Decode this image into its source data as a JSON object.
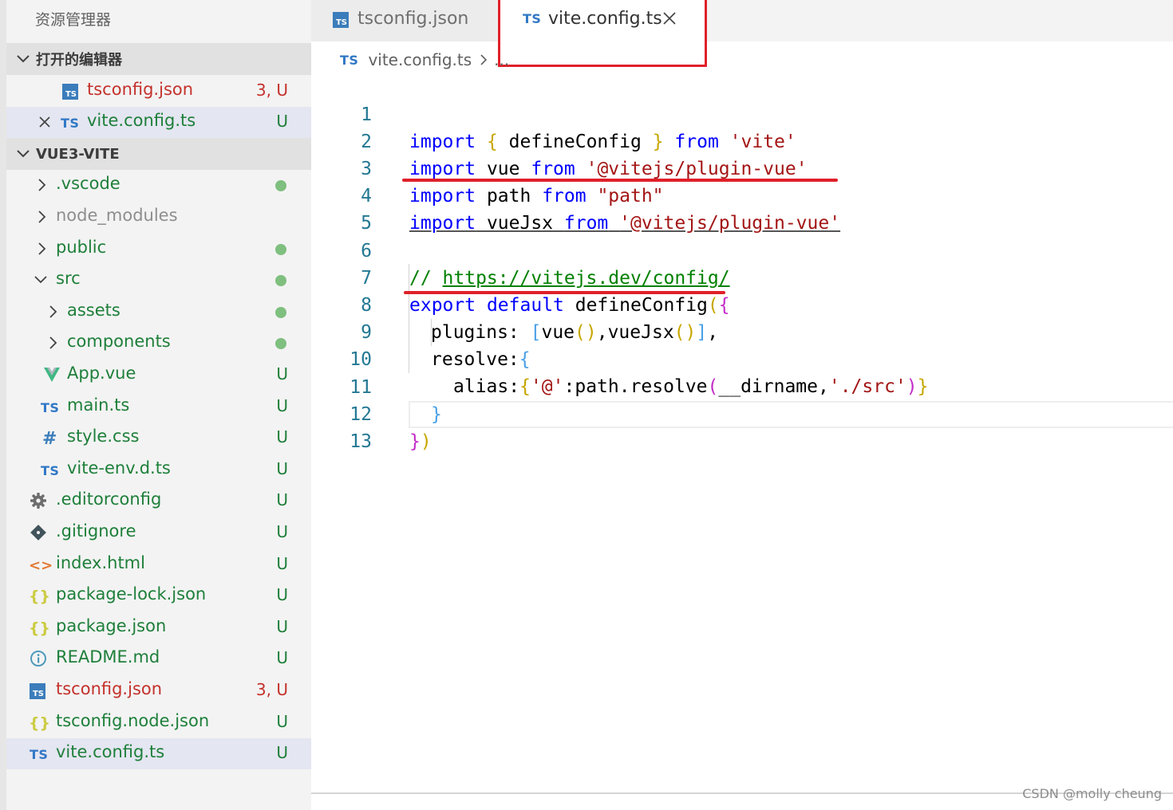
{
  "explorer": {
    "title": "资源管理器",
    "open_editors": {
      "header": "打开的编辑器",
      "items": [
        {
          "name": "tsconfig.json",
          "status": "3, U"
        },
        {
          "name": "vite.config.ts",
          "status": "U"
        }
      ]
    },
    "project": {
      "header": "VUE3-VITE",
      "items": [
        {
          "name": ".vscode",
          "kind": "folder",
          "status": "dot"
        },
        {
          "name": "node_modules",
          "kind": "folder",
          "status": ""
        },
        {
          "name": "public",
          "kind": "folder",
          "status": "dot"
        },
        {
          "name": "src",
          "kind": "folder-open",
          "status": "dot"
        },
        {
          "name": "assets",
          "kind": "folder",
          "status": "dot"
        },
        {
          "name": "components",
          "kind": "folder",
          "status": "dot"
        },
        {
          "name": "App.vue",
          "kind": "vue-icon",
          "status": "U"
        },
        {
          "name": "main.ts",
          "kind": "ts-icon",
          "status": "U"
        },
        {
          "name": "style.css",
          "kind": "hash-icon",
          "status": "U"
        },
        {
          "name": "vite-env.d.ts",
          "kind": "ts-icon",
          "status": "U"
        },
        {
          "name": ".editorconfig",
          "kind": "gear-icon",
          "status": "U"
        },
        {
          "name": ".gitignore",
          "kind": "git-icon",
          "status": "U"
        },
        {
          "name": "index.html",
          "kind": "html-icon",
          "status": "U"
        },
        {
          "name": "package-lock.json",
          "kind": "json-icon",
          "status": "U"
        },
        {
          "name": "package.json",
          "kind": "json-icon",
          "status": "U"
        },
        {
          "name": "README.md",
          "kind": "info-icon",
          "status": "U"
        },
        {
          "name": "tsconfig.json",
          "kind": "tsconfig-icon",
          "status": "3, U"
        },
        {
          "name": "tsconfig.node.json",
          "kind": "json-icon",
          "status": "U"
        },
        {
          "name": "vite.config.ts",
          "kind": "ts-icon",
          "status": "U"
        }
      ]
    }
  },
  "tabs": [
    {
      "label": "tsconfig.json",
      "icon": "tsconfig-icon",
      "active": false
    },
    {
      "label": "vite.config.ts",
      "icon": "ts-icon",
      "active": true
    }
  ],
  "icons": {
    "ts": "TS",
    "ts_box": "TS",
    "hash": "#",
    "vue": "V",
    "html": "<>",
    "json": "{}",
    "info": "i"
  },
  "breadcrumb": {
    "file": "vite.config.ts",
    "more": "..."
  },
  "line_numbers": [
    "1",
    "2",
    "3",
    "4",
    "5",
    "6",
    "7",
    "8",
    "9",
    "10",
    "11",
    "12",
    "13"
  ],
  "code": {
    "l1": [
      "import",
      " ",
      "{",
      " defineConfig ",
      "}",
      " ",
      "from",
      " ",
      "'vite'"
    ],
    "l2": [
      "import",
      " vue ",
      "from",
      " ",
      "'@vitejs/plugin-vue'"
    ],
    "l3": [
      "import",
      " path ",
      "from",
      " ",
      "\"path\""
    ],
    "l4": [
      "import",
      " vueJsx ",
      "from",
      " ",
      "'@vitejs/plugin-vue'"
    ],
    "l6": [
      "// ",
      "https://vitejs.dev/config/"
    ],
    "l7": [
      "export",
      " ",
      "default",
      " defineConfig",
      "(",
      "{"
    ],
    "l8": [
      "plugins: ",
      "[",
      "vue",
      "()",
      ",vueJsx",
      "()",
      "]",
      ","
    ],
    "l9": [
      "resolve:",
      "{"
    ],
    "l10": [
      "alias:",
      "{",
      "'@'",
      ":path.resolve",
      "(",
      "__dirname,",
      "'./src'",
      ")",
      "}"
    ],
    "l11": [
      "}"
    ],
    "l12": [
      "}",
      ")"
    ]
  },
  "colors": {
    "keyword": "#0000ff",
    "string": "#a31515",
    "comment": "#008000",
    "git_untracked": "#1e7f3a",
    "git_error": "#c4312c",
    "dot": "#7fbf7f",
    "highlight": "#e0202a"
  },
  "watermark": "CSDN @molly cheung"
}
